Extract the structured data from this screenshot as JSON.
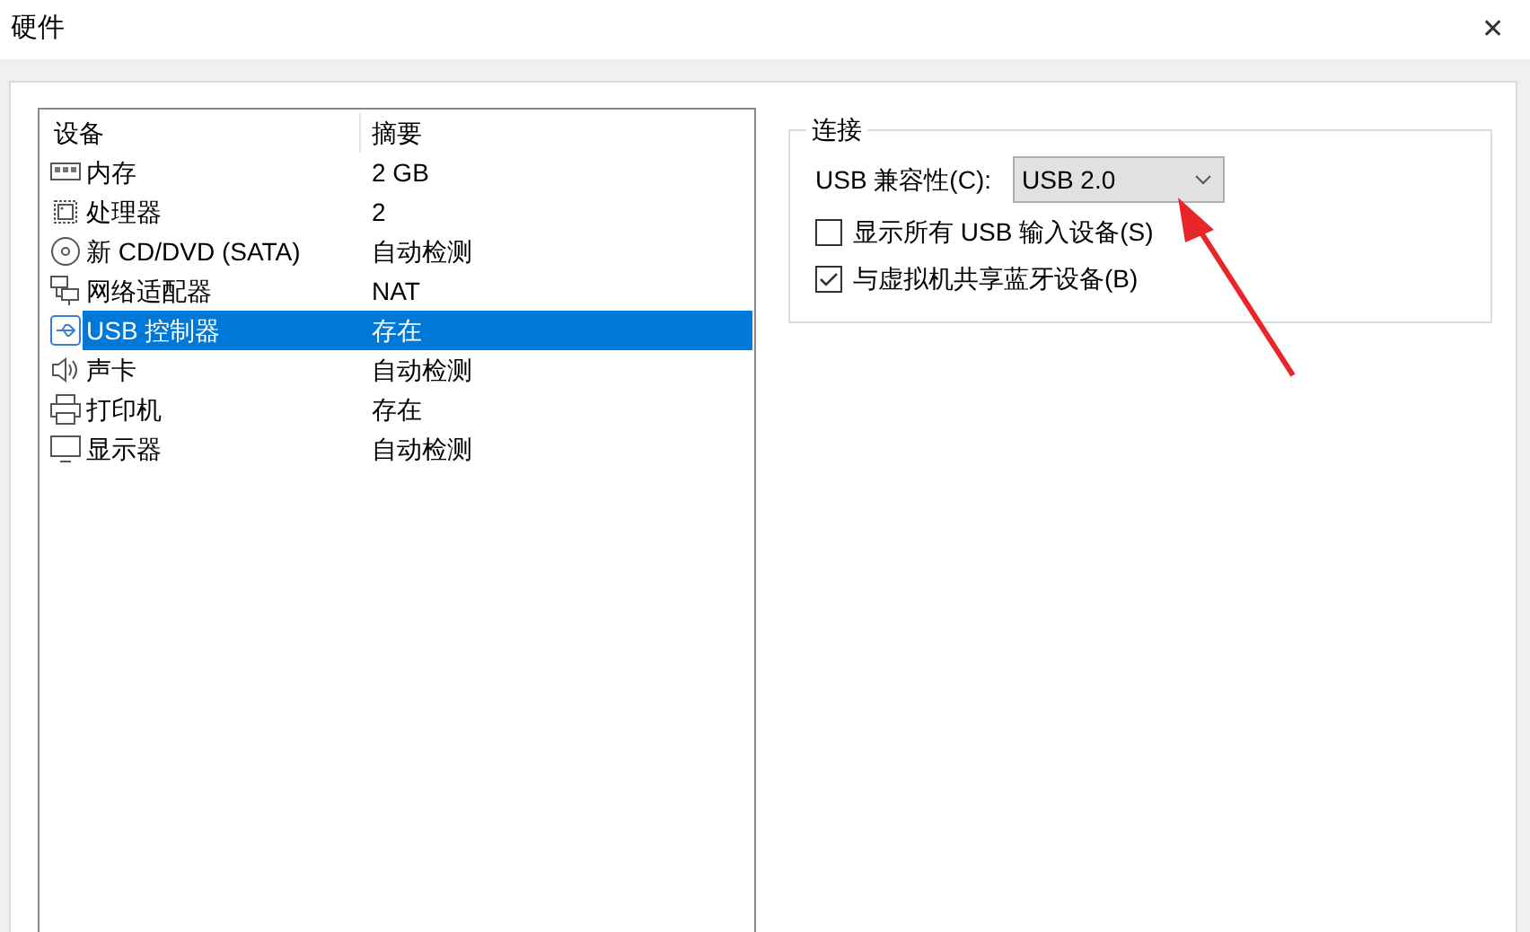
{
  "window": {
    "title": "硬件",
    "close": "✕"
  },
  "device_list": {
    "columns": [
      "设备",
      "摘要"
    ],
    "rows": [
      {
        "kind": "memory",
        "device": "内存",
        "summary": "2 GB",
        "selected": false
      },
      {
        "kind": "cpu",
        "device": "处理器",
        "summary": "2",
        "selected": false
      },
      {
        "kind": "disc",
        "device": "新 CD/DVD (SATA)",
        "summary": "自动检测",
        "selected": false
      },
      {
        "kind": "network",
        "device": "网络适配器",
        "summary": "NAT",
        "selected": false
      },
      {
        "kind": "usb",
        "device": "USB 控制器",
        "summary": "存在",
        "selected": true
      },
      {
        "kind": "sound",
        "device": "声卡",
        "summary": "自动检测",
        "selected": false
      },
      {
        "kind": "printer",
        "device": "打印机",
        "summary": "存在",
        "selected": false
      },
      {
        "kind": "display",
        "device": "显示器",
        "summary": "自动检测",
        "selected": false
      }
    ]
  },
  "connection": {
    "legend": "连接",
    "compat_label": "USB 兼容性(C):",
    "compat_value": "USB 2.0",
    "options": [
      {
        "label": "显示所有 USB 输入设备(S)",
        "checked": false
      },
      {
        "label": "与虚拟机共享蓝牙设备(B)",
        "checked": true
      }
    ]
  }
}
